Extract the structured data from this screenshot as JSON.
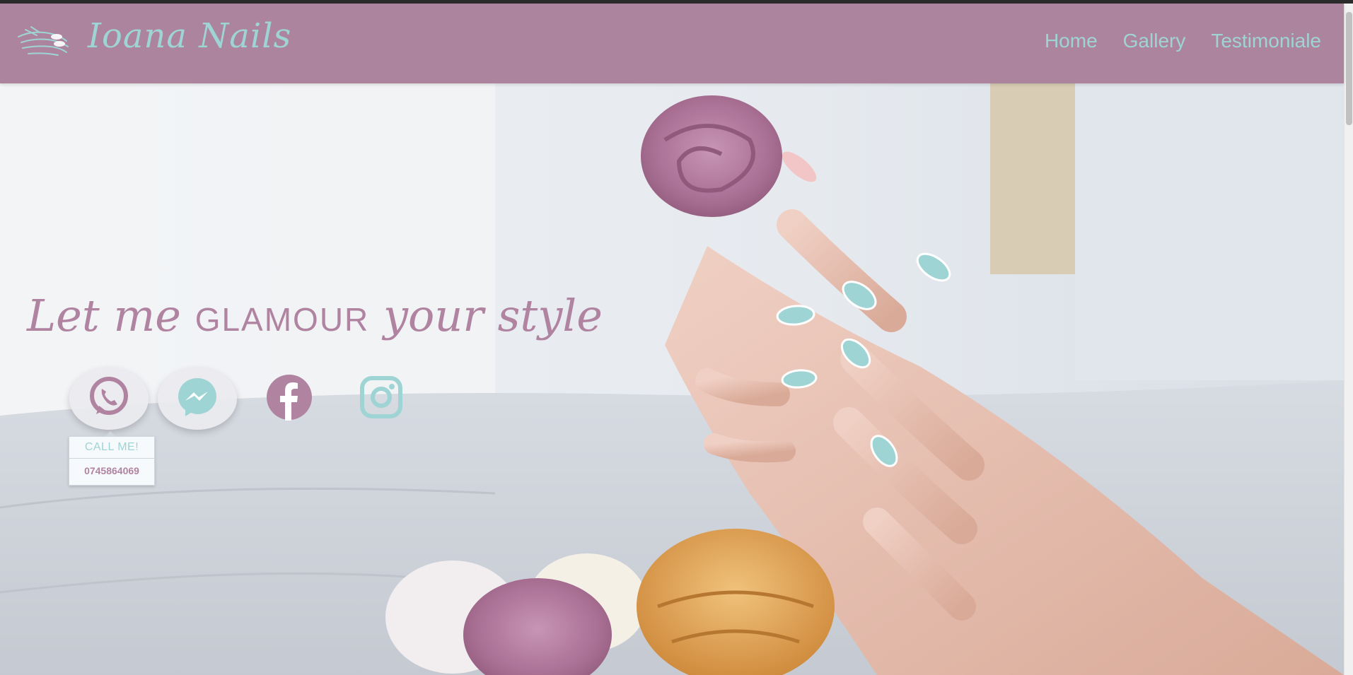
{
  "header": {
    "brand": "Ioana Nails",
    "nav": [
      "Home",
      "Gallery",
      "Testimoniale"
    ]
  },
  "hero": {
    "tagline_part1": "Let me ",
    "tagline_part2": "GLAMOUR",
    "tagline_part3": " your style"
  },
  "social": {
    "icons": [
      "whatsapp-icon",
      "messenger-icon",
      "facebook-icon",
      "instagram-icon"
    ]
  },
  "contact_popup": {
    "label": "CALL ME!",
    "phone": "0745864069"
  },
  "colors": {
    "header_bg": "#ad849e",
    "teal": "#9fd4d4",
    "mauve": "#b084a1"
  }
}
